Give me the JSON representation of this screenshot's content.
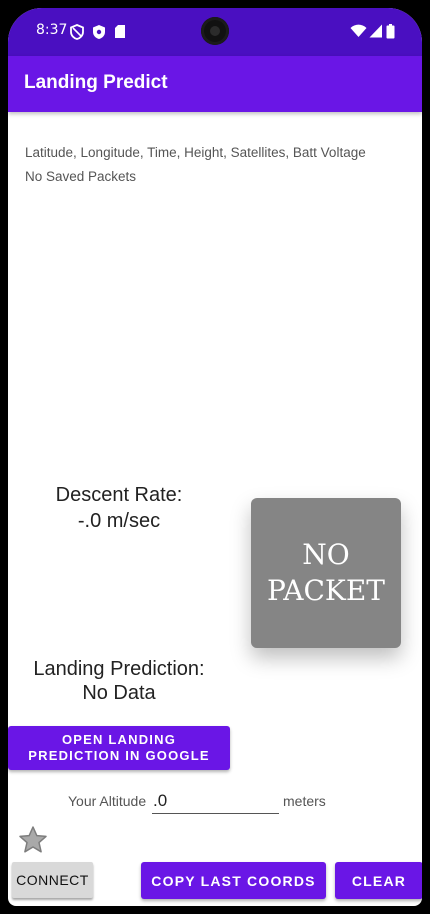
{
  "status_bar": {
    "time": "8:37",
    "icons": [
      "shield-outline-icon",
      "shield-icon",
      "sd-card-icon",
      "wifi-icon",
      "cell-signal-icon",
      "battery-icon"
    ]
  },
  "app_bar": {
    "title": "Landing Predict"
  },
  "info": {
    "header_line": "Latitude, Longitude, Time, Height, Satellites, Batt Voltage",
    "saved_packets": "No Saved Packets"
  },
  "descent": {
    "label": "Descent Rate:",
    "value": "-.0 m/sec"
  },
  "packet_status": {
    "line1": "NO",
    "line2": "PACKET"
  },
  "prediction": {
    "label": "Landing Prediction:",
    "value": "No Data"
  },
  "open_button": {
    "line1": "OPEN LANDING",
    "line2": "PREDICTION IN GOOGLE"
  },
  "altitude": {
    "label": "Your Altitude",
    "value": ".0",
    "unit": "meters"
  },
  "buttons": {
    "connect": "CONNECT",
    "copy": "COPY LAST COORDS",
    "clear": "CLEAR"
  },
  "colors": {
    "status_bar": "#4a0fc1",
    "app_bar": "#6a16e6",
    "accent": "#6a16e6",
    "packet_box": "#858585"
  }
}
